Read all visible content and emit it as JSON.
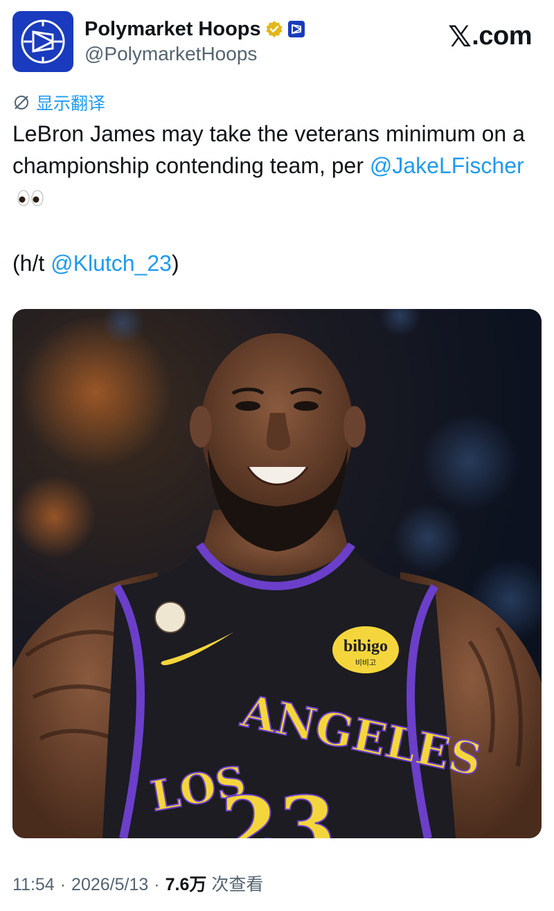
{
  "author": {
    "display_name": "Polymarket Hoops",
    "handle": "@PolymarketHoops",
    "avatar_icon": "polymarket-logo-icon",
    "verified_icon": "gold-verified-badge-icon",
    "affiliate_icon": "polymarket-affiliate-badge-icon"
  },
  "site": {
    "label": ".com",
    "logo_icon": "x-logo-icon"
  },
  "translate": {
    "label": "显示翻译",
    "icon": "translate-globe-icon"
  },
  "tweet": {
    "line1": "LeBron James may take the veterans minimum on a championship contending team, per ",
    "mention1": "@JakeLFischer",
    "emoji": "eyes-emoji",
    "ht_prefix": "(h/t ",
    "mention2": "@Klutch_23",
    "ht_suffix": ")"
  },
  "photo": {
    "jersey_text": [
      "LOS",
      "ANGELES"
    ],
    "number": "23",
    "patch_text": "bibigo",
    "patch_subtext": "비비고"
  },
  "meta": {
    "time": "11:54",
    "sep1": "·",
    "date": "2026/5/13",
    "sep2": "·",
    "views": "7.6万",
    "views_label": "次查看"
  },
  "colors": {
    "link": "#1d9bf0",
    "muted": "#536471",
    "avatar_bg": "#1a3bbd",
    "jersey": "#1c1c22",
    "jersey_trim": "#6b3fc9",
    "jersey_letters": "#f4d63c"
  }
}
